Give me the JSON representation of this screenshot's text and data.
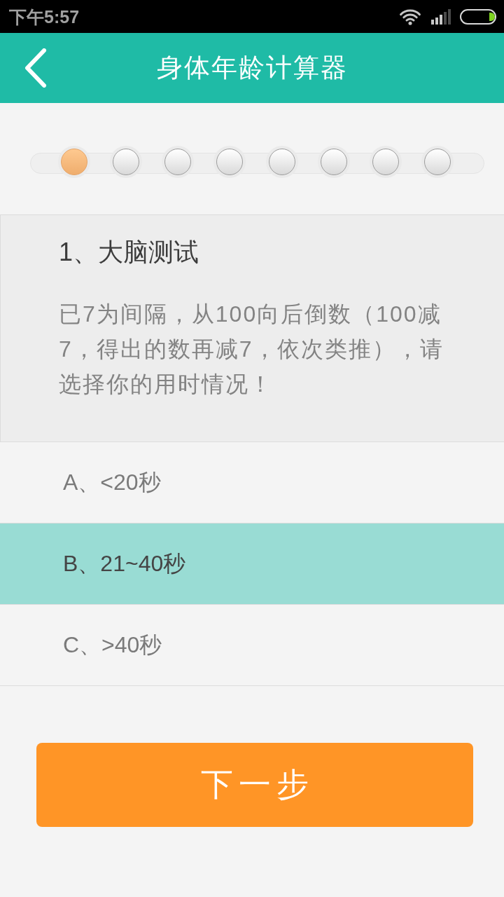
{
  "status_bar": {
    "time": "下午5:57"
  },
  "app_bar": {
    "title": "身体年龄计算器"
  },
  "steps": [
    {
      "selected": true
    },
    {
      "selected": false
    },
    {
      "selected": false
    },
    {
      "selected": false
    },
    {
      "selected": false
    },
    {
      "selected": false
    },
    {
      "selected": false
    },
    {
      "selected": false
    }
  ],
  "question": {
    "title": "1、大脑测试",
    "text": "已7为间隔，从100向后倒数（100减7，得出的数再减7，依次类推），请选择你的用时情况！"
  },
  "options": [
    {
      "label": "A、<20秒",
      "selected": false
    },
    {
      "label": "B、21~40秒",
      "selected": true
    },
    {
      "label": "C、>40秒",
      "selected": false
    }
  ],
  "next_button": {
    "label": "下一步"
  }
}
